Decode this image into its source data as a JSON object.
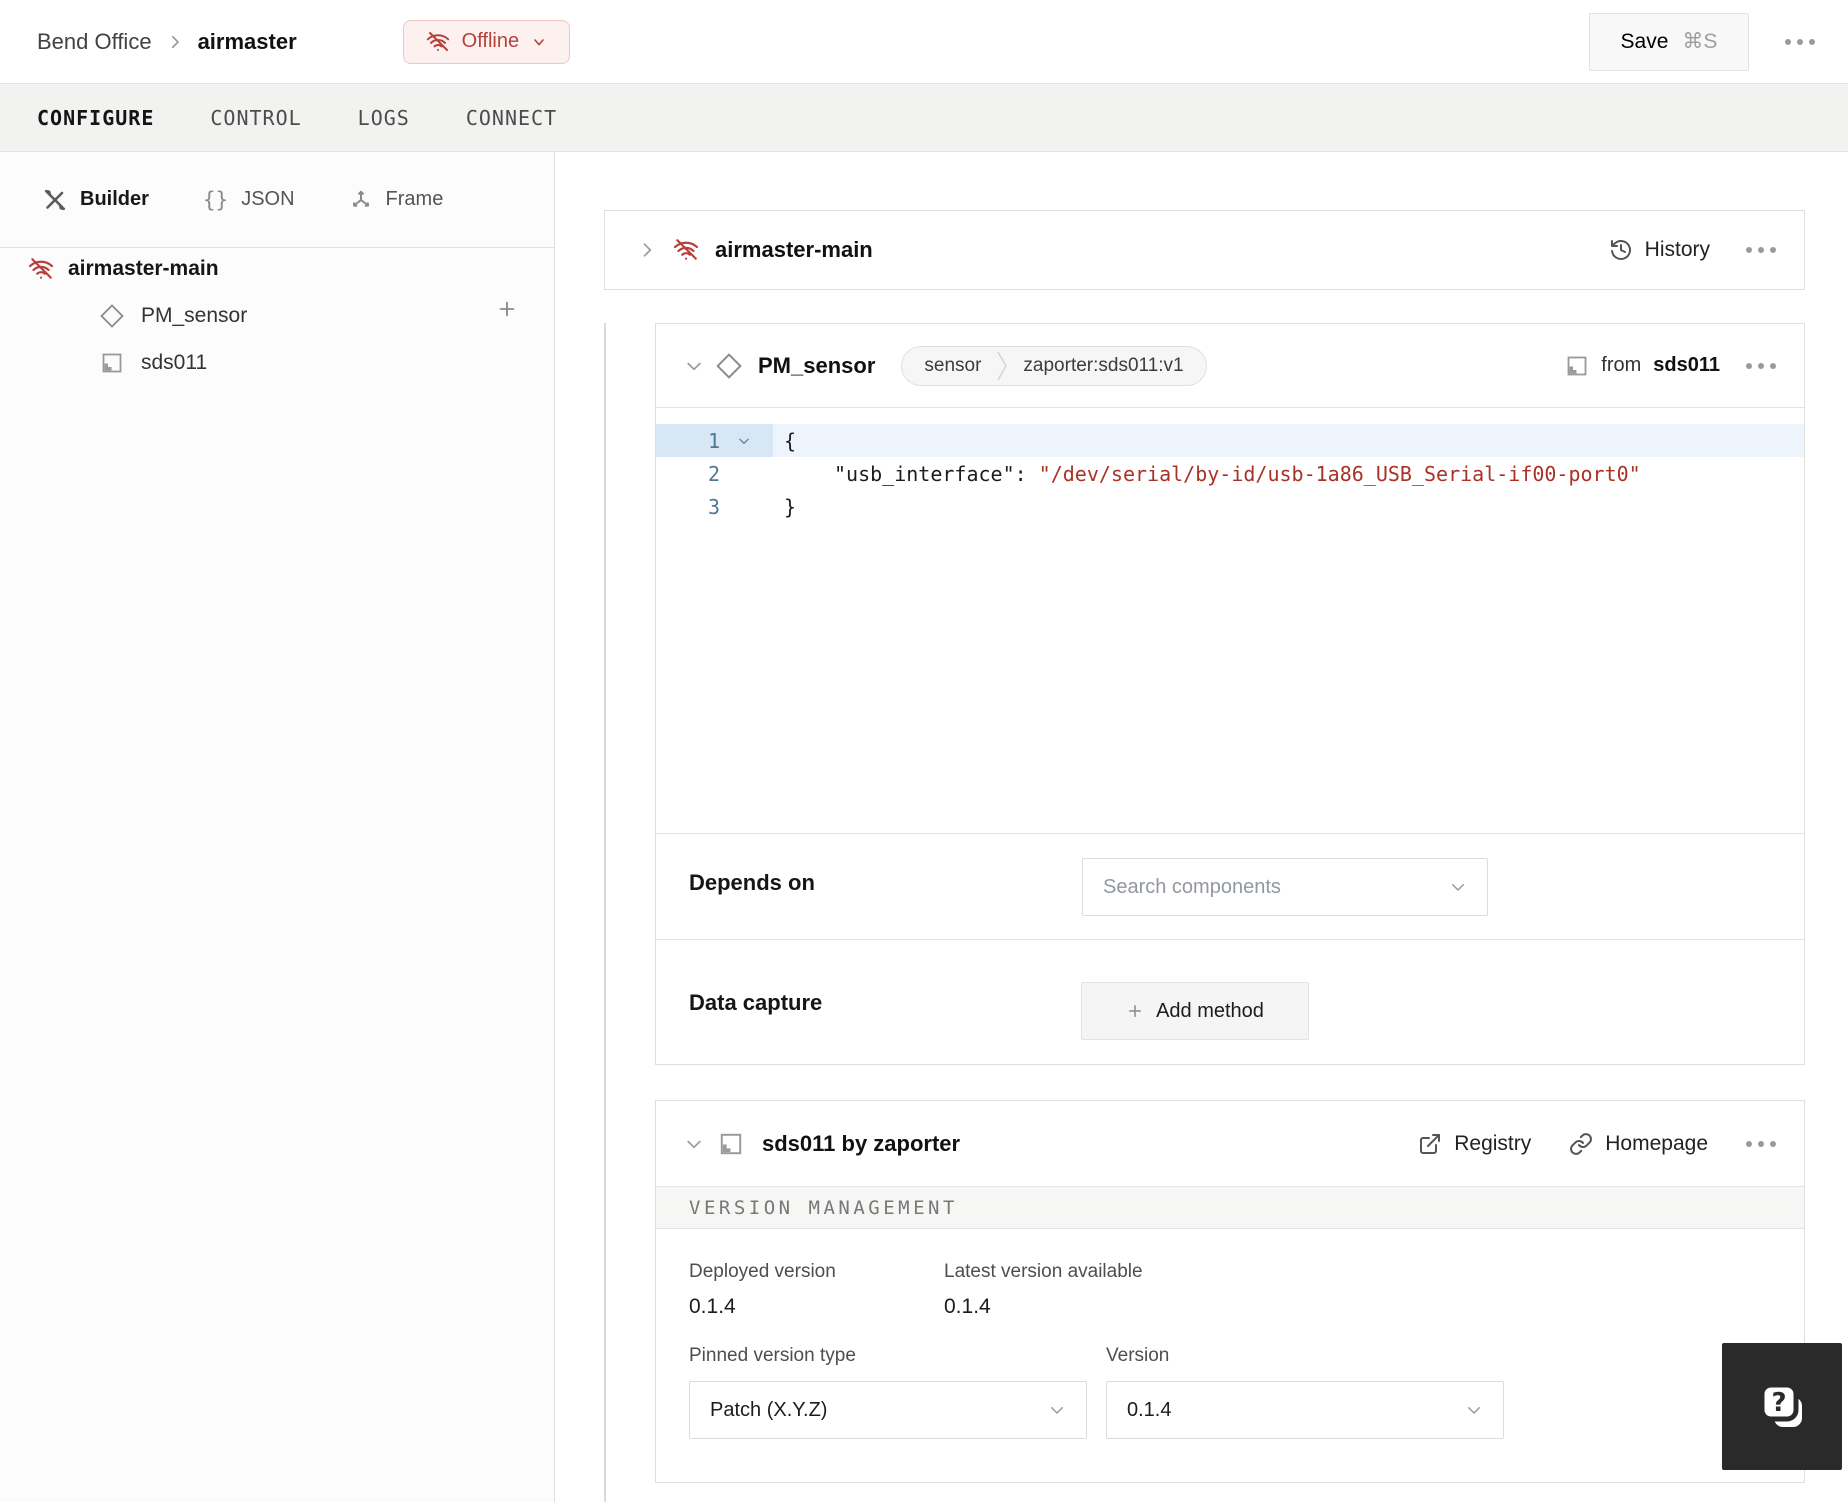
{
  "topbar": {
    "breadcrumb": {
      "org": "Bend Office",
      "machine": "airmaster"
    },
    "status_badge": {
      "label": "Offline"
    },
    "save_button": {
      "label": "Save",
      "shortcut": "⌘S"
    }
  },
  "tabs": {
    "active": "CONFIGURE",
    "items": [
      {
        "label": "CONFIGURE"
      },
      {
        "label": "CONTROL"
      },
      {
        "label": "LOGS"
      },
      {
        "label": "CONNECT"
      }
    ]
  },
  "sidebar": {
    "modes": [
      {
        "label": "Builder"
      },
      {
        "label": "JSON"
      },
      {
        "label": "Frame"
      }
    ],
    "tree": {
      "part": "airmaster-main",
      "children": [
        {
          "name": "PM_sensor"
        },
        {
          "name": "sds011"
        }
      ]
    }
  },
  "part_card": {
    "title": "airmaster-main",
    "history_label": "History"
  },
  "component_card": {
    "title": "PM_sensor",
    "type_tag": "sensor",
    "model_tag": "zaporter:sds011:v1",
    "from_label": "from",
    "from_module": "sds011",
    "code": {
      "line_numbers": [
        "1",
        "2",
        "3"
      ],
      "line1": "{",
      "key": "\"usb_interface\"",
      "colon": ":",
      "value": "\"/dev/serial/by-id/usb-1a86_USB_Serial-if00-port0\"",
      "line3": "}"
    },
    "depends_on": {
      "label": "Depends on",
      "placeholder": "Search components"
    },
    "data_capture": {
      "label": "Data capture",
      "button": "Add method"
    }
  },
  "module_card": {
    "title": "sds011 by zaporter",
    "registry_label": "Registry",
    "homepage_label": "Homepage",
    "section_title": "VERSION MANAGEMENT",
    "deployed": {
      "label": "Deployed version",
      "value": "0.1.4"
    },
    "latest": {
      "label": "Latest version available",
      "value": "0.1.4"
    },
    "pinned": {
      "label": "Pinned version type",
      "value": "Patch (X.Y.Z)"
    },
    "version": {
      "label": "Version",
      "value": "0.1.4"
    }
  },
  "colors": {
    "accent_red": "#b5413d",
    "code_string": "#a93226",
    "line_number": "#4a7a96"
  }
}
